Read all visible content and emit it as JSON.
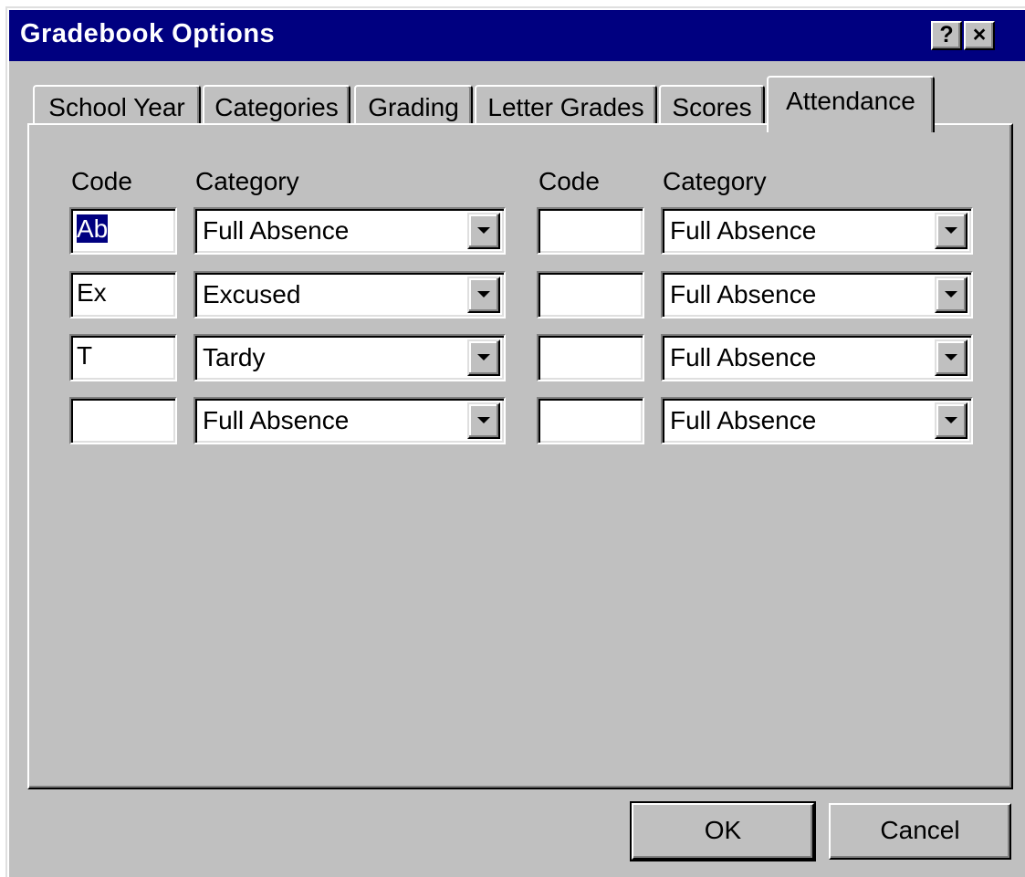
{
  "window": {
    "title": "Gradebook Options",
    "help_label": "?",
    "close_label": "×"
  },
  "tabs": [
    {
      "label": "School Year",
      "active": false
    },
    {
      "label": "Categories",
      "active": false
    },
    {
      "label": "Grading",
      "active": false
    },
    {
      "label": "Letter Grades",
      "active": false
    },
    {
      "label": "Scores",
      "active": false
    },
    {
      "label": "Attendance",
      "active": true
    }
  ],
  "attendance": {
    "code_header": "Code",
    "category_header": "Category",
    "left_rows": [
      {
        "code": "Ab",
        "category": "Full Absence",
        "code_selected": true
      },
      {
        "code": "Ex",
        "category": "Excused"
      },
      {
        "code": "T",
        "category": "Tardy"
      },
      {
        "code": "",
        "category": "Full Absence"
      }
    ],
    "right_rows": [
      {
        "code": "",
        "category": "Full Absence"
      },
      {
        "code": "",
        "category": "Full Absence"
      },
      {
        "code": "",
        "category": "Full Absence"
      },
      {
        "code": "",
        "category": "Full Absence"
      }
    ],
    "icons": {
      "dropdown": "chevron-down-icon"
    }
  },
  "buttons": {
    "ok_label": "OK",
    "cancel_label": "Cancel"
  },
  "colors": {
    "titlebar": "#000080",
    "face": "#c0c0c0",
    "selection": "#000080"
  }
}
